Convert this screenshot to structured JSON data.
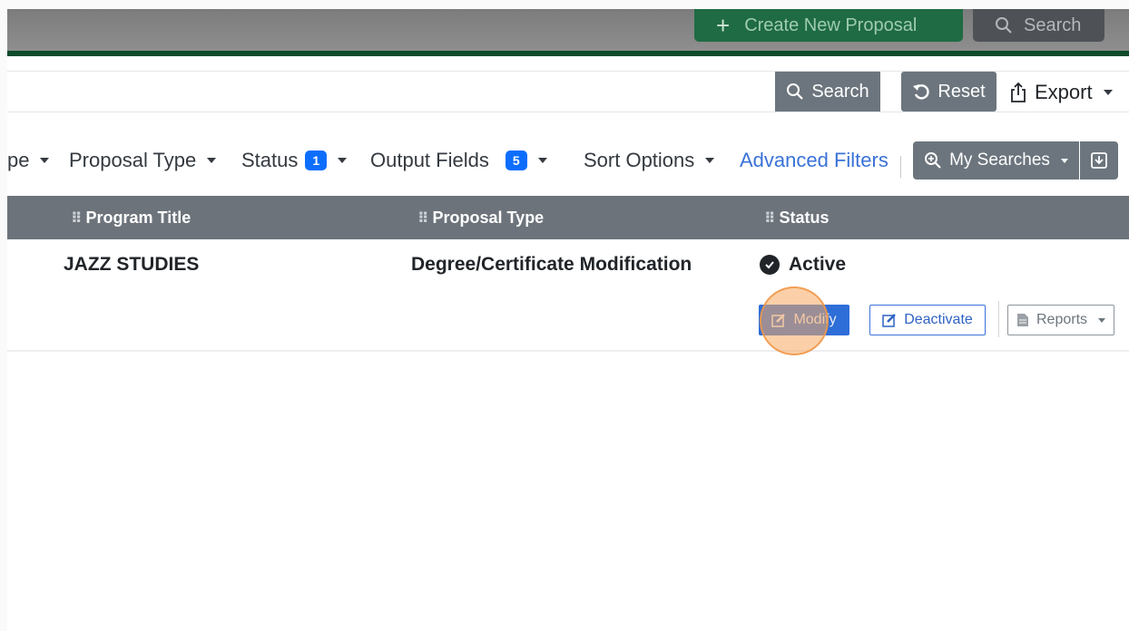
{
  "header": {
    "create_label": "Create New Proposal",
    "search_label": "Search"
  },
  "search_bar": {
    "input_value": "",
    "search_label": "Search",
    "reset_label": "Reset",
    "export_label": "Export"
  },
  "filters": {
    "items": [
      {
        "label": "pe"
      },
      {
        "label": "Proposal Type"
      },
      {
        "label": "Status",
        "badge": "1"
      },
      {
        "label": "Output Fields",
        "badge": "5"
      },
      {
        "label": "Sort Options"
      }
    ],
    "advanced_label": "Advanced Filters",
    "my_searches_label": "My Searches"
  },
  "table": {
    "columns": [
      "Program Title",
      "Proposal Type",
      "Status"
    ],
    "rows": [
      {
        "program_title": "JAZZ STUDIES",
        "proposal_type": "Degree/Certificate Modification",
        "status": "Active",
        "actions": {
          "modify": "Modify",
          "deactivate": "Deactivate",
          "reports": "Reports"
        }
      }
    ]
  },
  "colors": {
    "create_button": "#1f6b43",
    "primary": "#2e6ed8",
    "secondary": "#6c757d",
    "badge": "#0d6efd",
    "click_marker": "#f7aa60"
  }
}
